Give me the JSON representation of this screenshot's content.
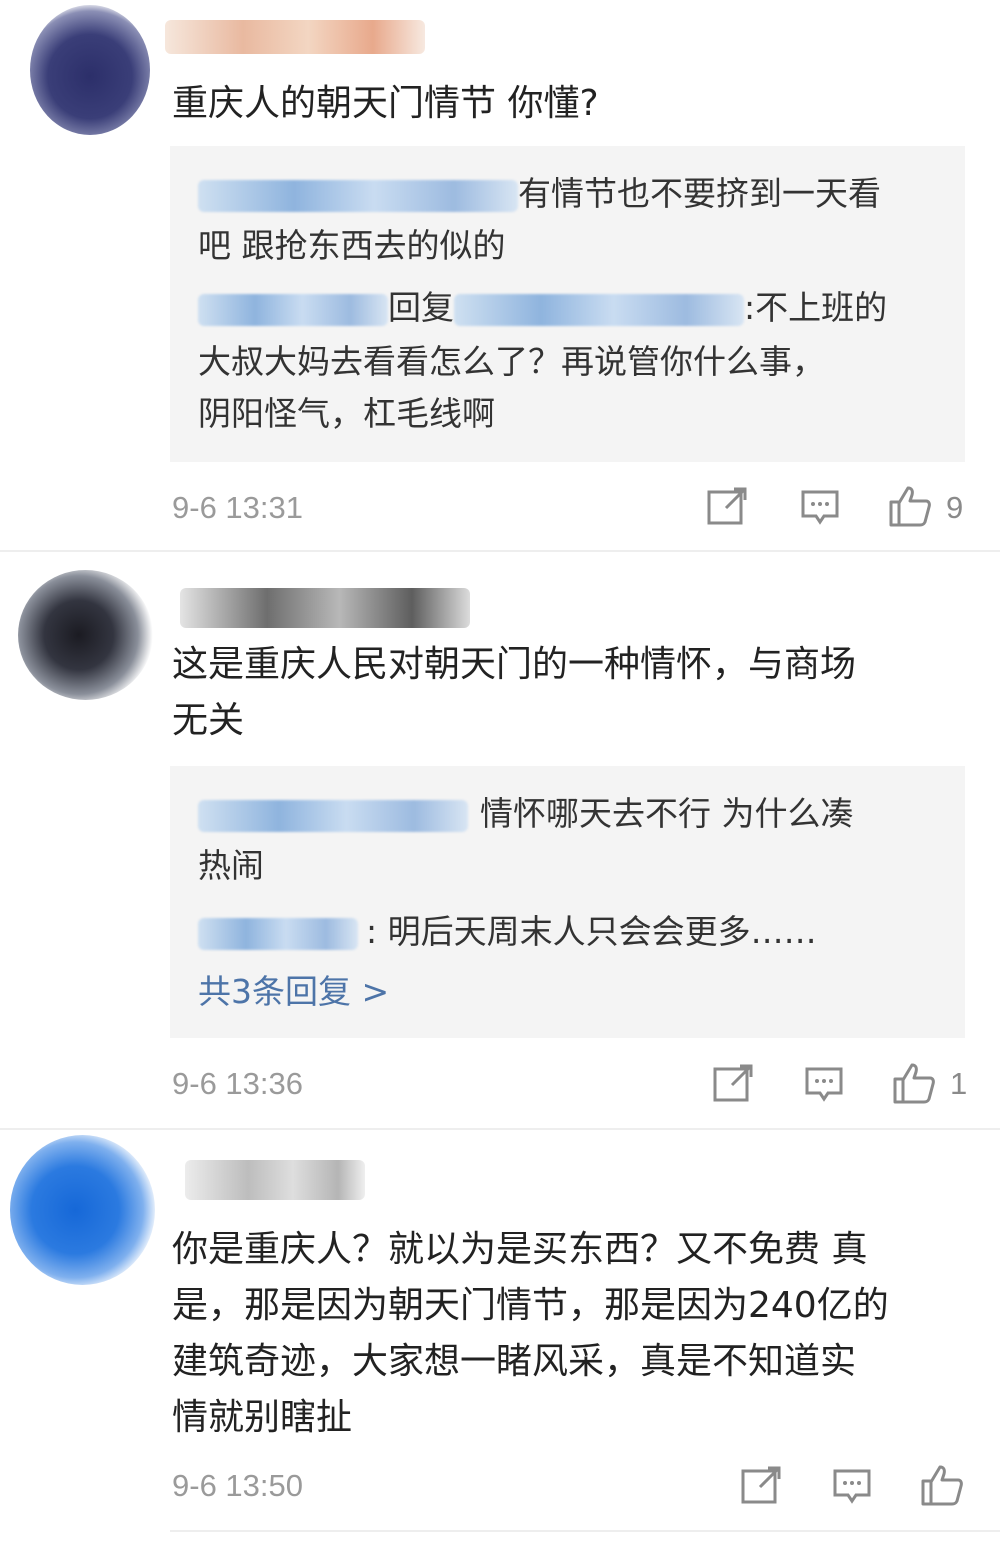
{
  "comments": [
    {
      "text": "重庆人的朝天门情节 你懂?",
      "replies": [
        {
          "line1": "有情节也不要挤到一天看",
          "line2": "吧 跟抢东西去的似的"
        },
        {
          "prefix": "回复",
          "line1": ":不上班的",
          "line2": "大叔大妈去看看怎么了？再说管你什么事，",
          "line3": "阴阳怪气，杠毛线啊"
        }
      ],
      "time": "9-6 13:31",
      "likes": "9"
    },
    {
      "text_line1": "这是重庆人民对朝天门的一种情怀，与商场",
      "text_line2": "无关",
      "replies": [
        {
          "line1": "情怀哪天去不行 为什么凑",
          "line2": "热闹"
        },
        {
          "line1": ": 明后天周末人只会会更多……"
        }
      ],
      "more": "共3条回复 >",
      "time": "9-6 13:36",
      "likes": "1"
    },
    {
      "text_line1": "你是重庆人？就以为是买东西？又不免费 真",
      "text_line2": "是，那是因为朝天门情节，那是因为240亿的",
      "text_line3": "建筑奇迹，大家想一睹风采，真是不知道实",
      "text_line4": "情就别瞎扯",
      "time": "9-6 13:50",
      "likes": ""
    }
  ],
  "icons": {
    "share": "share-icon",
    "comment": "comment-icon",
    "like": "thumbs-up-icon"
  },
  "colors": {
    "link": "#4d74a8",
    "meta": "#9a9a9a",
    "reply_bg": "#f4f4f4"
  }
}
